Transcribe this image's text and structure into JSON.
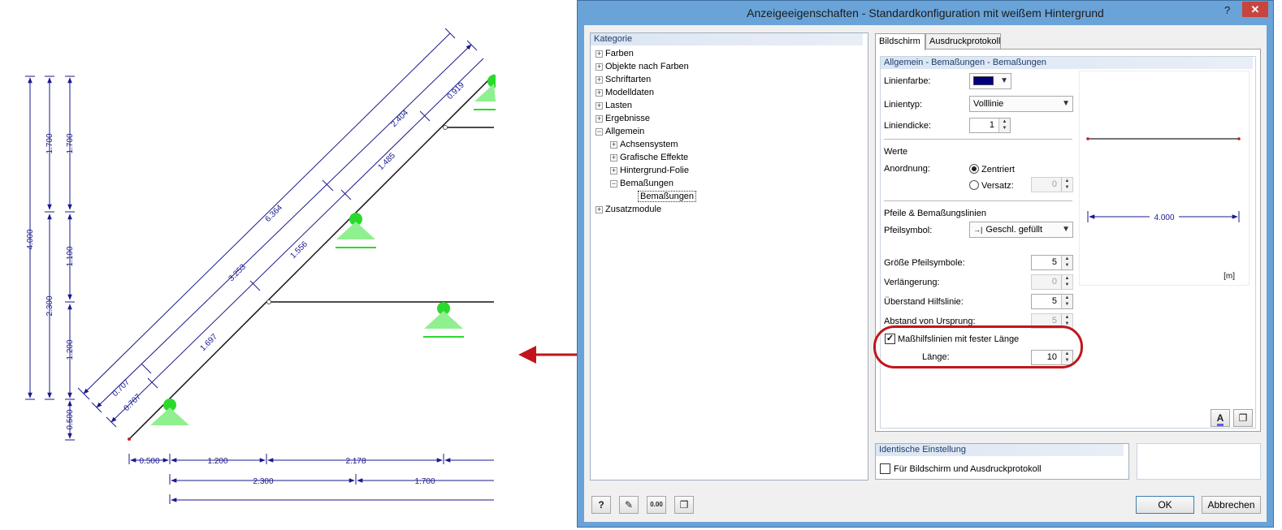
{
  "dialog": {
    "title": "Anzeigeeigenschaften - Standardkonfiguration mit weißem Hintergrund",
    "help_glyph": "?",
    "close_glyph": "✕"
  },
  "kategorie": {
    "header": "Kategorie",
    "items": [
      {
        "label": "Farben",
        "expander": "+"
      },
      {
        "label": "Objekte nach Farben",
        "expander": "+"
      },
      {
        "label": "Schriftarten",
        "expander": "+"
      },
      {
        "label": "Modelldaten",
        "expander": "+"
      },
      {
        "label": "Lasten",
        "expander": "+"
      },
      {
        "label": "Ergebnisse",
        "expander": "+"
      },
      {
        "label": "Allgemein",
        "expander": "−"
      },
      {
        "label": "Achsensystem",
        "expander": "+"
      },
      {
        "label": "Grafische Effekte",
        "expander": "+"
      },
      {
        "label": "Hintergrund-Folie",
        "expander": "+"
      },
      {
        "label": "Bemaßungen",
        "expander": "−"
      },
      {
        "label": "Bemaßungen",
        "expander": ""
      },
      {
        "label": "Zusatzmodule",
        "expander": "+"
      }
    ]
  },
  "tabs": [
    {
      "label": "Bildschirm"
    },
    {
      "label": "Ausdruckprotokoll"
    }
  ],
  "settings": {
    "header": "Allgemein - Bemaßungen - Bemaßungen",
    "linienfarbe_label": "Linienfarbe:",
    "linienfarbe_color": "#000080",
    "linientyp_label": "Linientyp:",
    "linientyp_value": "Volllinie",
    "liniendicke_label": "Liniendicke:",
    "liniendicke_value": "1",
    "werte_label": "Werte",
    "anordnung_label": "Anordnung:",
    "zentriert_label": "Zentriert",
    "versatz_label": "Versatz:",
    "versatz_value": "0",
    "pfeile_label": "Pfeile & Bemaßungslinien",
    "pfeilsymbol_label": "Pfeilsymbol:",
    "pfeilsymbol_glyph": "→|",
    "pfeilsymbol_value": "Geschl. gefüllt",
    "groesse_label": "Größe Pfeilsymbole:",
    "groesse_value": "5",
    "verlaengerung_label": "Verlängerung:",
    "verlaengerung_value": "0",
    "ueberstand_label": "Überstand Hilfslinie:",
    "ueberstand_value": "5",
    "abstand_label": "Abstand von Ursprung:",
    "abstand_value": "5",
    "feste_laenge_label": "Maßhilfslinien mit fester Länge",
    "feste_laenge_checked": "✓",
    "laenge_label": "Länge:",
    "laenge_value": "10",
    "preview_value": "4.000",
    "preview_unit": "[m]",
    "highlight_color": "#c0161b"
  },
  "identisch": {
    "header": "Identische Einstellung",
    "checkbox_label": "Für Bildschirm und Ausdruckprotokoll"
  },
  "buttons": {
    "ok": "OK",
    "cancel": "Abbrechen",
    "units_icon": "0.00"
  },
  "drawing": {
    "dim_color": "#1a1a8c",
    "support_color": "#2bd92b",
    "vertical_dims": [
      "4.000",
      "1.700",
      "2.300",
      "1.700",
      "1.100",
      "1.200",
      "0.500"
    ],
    "horizontal_dims": [
      "0.500",
      "1.200",
      "2.178",
      "2.300",
      "1.700"
    ],
    "inclined_dims": [
      "6.364",
      "2.404",
      "0.919",
      "1.485",
      "3.253",
      "1.556",
      "1.697",
      "0.707",
      "0.707"
    ]
  }
}
